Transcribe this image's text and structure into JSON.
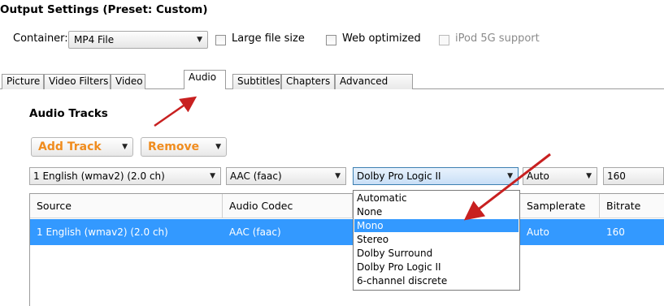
{
  "output": {
    "title": "Output Settings (Preset: Custom)",
    "container_label": "Container:",
    "container_value": "MP4 File",
    "large_file_size": {
      "label": "Large file size",
      "checked": false
    },
    "web_optimized": {
      "label": "Web optimized",
      "checked": false
    },
    "ipod_support": {
      "label": "iPod 5G support",
      "checked": false,
      "enabled": false
    }
  },
  "tabs": [
    {
      "label": "Picture",
      "active": false
    },
    {
      "label": "Video Filters",
      "active": false
    },
    {
      "label": "Video",
      "active": false
    },
    {
      "label": "Audio",
      "active": true
    },
    {
      "label": "Subtitles",
      "active": false
    },
    {
      "label": "Chapters",
      "active": false
    },
    {
      "label": "Advanced",
      "active": false
    }
  ],
  "audio": {
    "title": "Audio Tracks",
    "add_track": "Add Track",
    "remove": "Remove",
    "source_combo": "1 English (wmav2) (2.0 ch)",
    "codec_combo": "AAC (faac)",
    "mixdown_combo": "Dolby Pro Logic II",
    "samplerate_combo": "Auto",
    "bitrate_combo": "160",
    "table": {
      "headers": [
        "Source",
        "Audio Codec",
        "Samplerate",
        "Bitrate"
      ],
      "rows": [
        {
          "source": "1 English (wmav2) (2.0 ch)",
          "codec": "AAC (faac)",
          "samplerate": "Auto",
          "bitrate": "160"
        }
      ]
    },
    "mixdown_options": [
      "Automatic",
      "None",
      "Mono",
      "Stereo",
      "Dolby Surround",
      "Dolby Pro Logic II",
      "6-channel discrete"
    ],
    "mixdown_highlighted": "Mono"
  },
  "colors": {
    "accent_orange": "#f08c1e",
    "selection_blue": "#3399ff",
    "annotation_arrow": "#c82020"
  }
}
